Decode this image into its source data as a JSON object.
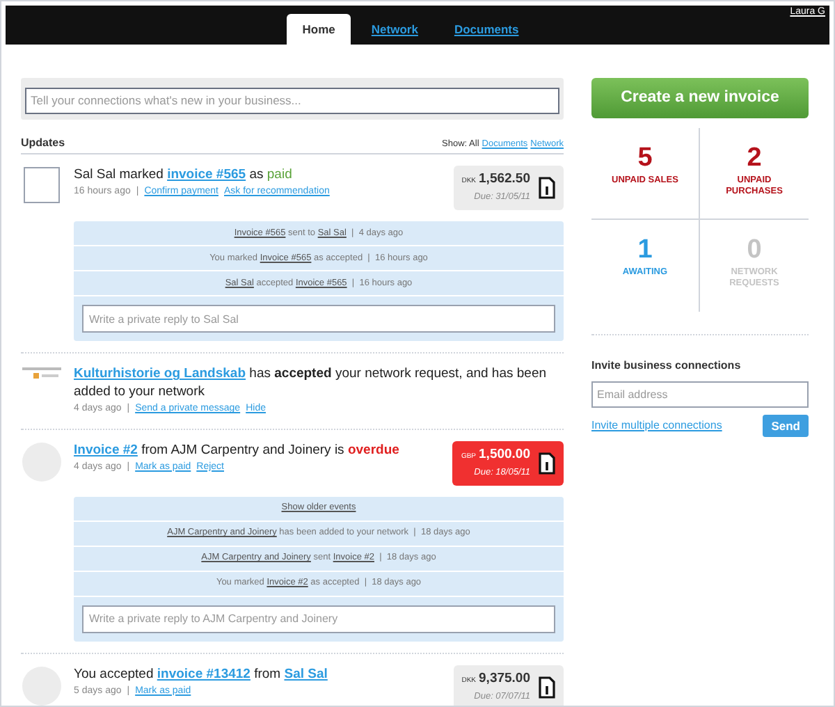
{
  "user": "Laura G",
  "tabs": [
    {
      "label": "Home",
      "selected": true
    },
    {
      "label": "Network",
      "selected": false
    },
    {
      "label": "Documents",
      "selected": false
    }
  ],
  "status_field": {
    "placeholder": "Tell your connections what's new in your business..."
  },
  "create_button": "Create a new invoice",
  "updates": {
    "title": "Updates",
    "show_label": "Show: All",
    "filters": [
      "Documents",
      "Network"
    ]
  },
  "feed": [
    {
      "kind": "square",
      "separator": "|",
      "headline": [
        {
          "kind": "text",
          "text": "Sal Sal marked "
        },
        {
          "kind": "link",
          "text": "invoice #565"
        },
        {
          "kind": "text",
          "text": " as "
        },
        {
          "kind": "good",
          "text": "paid"
        }
      ],
      "time": "16 hours ago",
      "actions": [
        "Confirm payment",
        "Ask for recommendation"
      ],
      "amount": {
        "currency": "DKK",
        "value": "1,562.50",
        "due": "Due: 31/05/11",
        "overdue": false
      },
      "events": [
        [
          {
            "kind": "link",
            "text": "Invoice #565"
          },
          {
            "kind": "text",
            "text": " sent to "
          },
          {
            "kind": "link",
            "text": "Sal Sal"
          },
          {
            "kind": "text",
            "text": "  |  4 days ago"
          }
        ],
        [
          {
            "kind": "text",
            "text": "You marked "
          },
          {
            "kind": "link",
            "text": "Invoice #565"
          },
          {
            "kind": "text",
            "text": " as accepted  |  16 hours ago"
          }
        ],
        [
          {
            "kind": "link",
            "text": "Sal Sal"
          },
          {
            "kind": "text",
            "text": " accepted "
          },
          {
            "kind": "link",
            "text": "Invoice #565"
          },
          {
            "kind": "text",
            "text": "  |  16 hours ago"
          }
        ]
      ],
      "reply": {
        "placeholder": "Write a private reply to Sal Sal"
      }
    },
    {
      "kind": "logo",
      "separator": "|",
      "headline": [
        {
          "kind": "link",
          "text": "Kulturhistorie og Landskab"
        },
        {
          "kind": "text",
          "text": " has "
        },
        {
          "kind": "bold",
          "text": "accepted"
        },
        {
          "kind": "text",
          "text": " your network request, and has been added to your network"
        }
      ],
      "time": "4 days ago",
      "actions": [
        "Send a private message",
        "Hide"
      ]
    },
    {
      "kind": "circle",
      "separator": "|",
      "headline": [
        {
          "kind": "link",
          "text": "Invoice #2"
        },
        {
          "kind": "text",
          "text": " from AJM Carpentry and Joinery is "
        },
        {
          "kind": "bad",
          "text": "overdue"
        }
      ],
      "time": "4 days ago",
      "actions": [
        "Mark as paid",
        "Reject"
      ],
      "amount": {
        "currency": "GBP",
        "value": "1,500.00",
        "due": "Due: 18/05/11",
        "overdue": true
      },
      "older": "Show older events",
      "events": [
        [
          {
            "kind": "link",
            "text": "AJM Carpentry and Joinery"
          },
          {
            "kind": "text",
            "text": " has been added to your network  |  18 days ago"
          }
        ],
        [
          {
            "kind": "link",
            "text": "AJM Carpentry and Joinery"
          },
          {
            "kind": "text",
            "text": " sent "
          },
          {
            "kind": "link",
            "text": "Invoice #2"
          },
          {
            "kind": "text",
            "text": "  |  18 days ago"
          }
        ],
        [
          {
            "kind": "text",
            "text": "You marked "
          },
          {
            "kind": "link",
            "text": "Invoice #2"
          },
          {
            "kind": "text",
            "text": " as accepted  |  18 days ago"
          }
        ]
      ],
      "reply": {
        "placeholder": "Write a private reply to AJM Carpentry and Joinery"
      }
    },
    {
      "kind": "circle",
      "separator": "|",
      "headline": [
        {
          "kind": "text",
          "text": "You accepted "
        },
        {
          "kind": "link",
          "text": "invoice #13412"
        },
        {
          "kind": "text",
          "text": " from "
        },
        {
          "kind": "link",
          "text": "Sal Sal"
        }
      ],
      "time": "5 days ago",
      "actions": [
        "Mark as paid"
      ],
      "amount": {
        "currency": "DKK",
        "value": "9,375.00",
        "due": "Due: 07/07/11",
        "overdue": false
      }
    }
  ],
  "stats": [
    {
      "value": "5",
      "label": "UNPAID SALES",
      "color": "#b5121b"
    },
    {
      "value": "2",
      "label": "UNPAID PURCHASES",
      "color": "#b5121b"
    },
    {
      "value": "1",
      "label": "AWAITING",
      "color": "#2b9be0"
    },
    {
      "value": "0",
      "label": "NETWORK REQUESTS",
      "color": "#c4c4c4"
    }
  ],
  "invite": {
    "title": "Invite business connections",
    "placeholder": "Email address",
    "link": "Invite multiple connections",
    "button": "Send"
  }
}
